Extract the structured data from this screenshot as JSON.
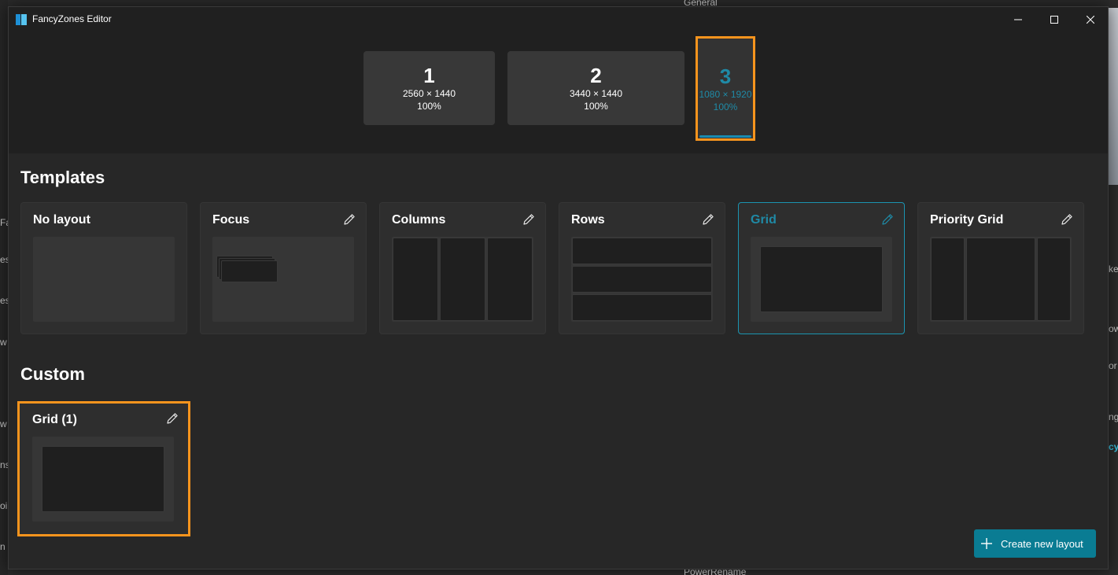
{
  "window": {
    "title": "FancyZones Editor",
    "icons": {
      "app": "fancyzones-app-icon",
      "minimize": "minimize-icon",
      "maximize": "maximize-icon",
      "close": "close-icon"
    }
  },
  "monitors": [
    {
      "number": "1",
      "resolution": "2560 × 1440",
      "scale": "100%",
      "selected": false
    },
    {
      "number": "2",
      "resolution": "3440 × 1440",
      "scale": "100%",
      "selected": false
    },
    {
      "number": "3",
      "resolution": "1080 × 1920",
      "scale": "100%",
      "selected": true
    }
  ],
  "templates": {
    "heading": "Templates",
    "items": [
      {
        "name": "No layout",
        "editable": false
      },
      {
        "name": "Focus",
        "editable": true
      },
      {
        "name": "Columns",
        "editable": true
      },
      {
        "name": "Rows",
        "editable": true
      },
      {
        "name": "Grid",
        "editable": true,
        "selected": true
      },
      {
        "name": "Priority Grid",
        "editable": true
      }
    ]
  },
  "custom": {
    "heading": "Custom",
    "items": [
      {
        "name": "Grid (1)",
        "editable": true
      }
    ]
  },
  "create_button": {
    "label": "Create new layout",
    "icon": "plus-icon"
  },
  "colors": {
    "accent": "#1f8aa6",
    "highlight": "#f7941d",
    "button": "#0a7c93"
  },
  "background_fragments": {
    "top": [
      "General"
    ],
    "bottom": [
      "PowerRename"
    ],
    "left": [
      "Fa",
      "es",
      "es,",
      "w",
      "w",
      "ns",
      "oi",
      "n"
    ],
    "right": [
      "ke",
      "ow",
      "or",
      "ng",
      "cy"
    ]
  }
}
